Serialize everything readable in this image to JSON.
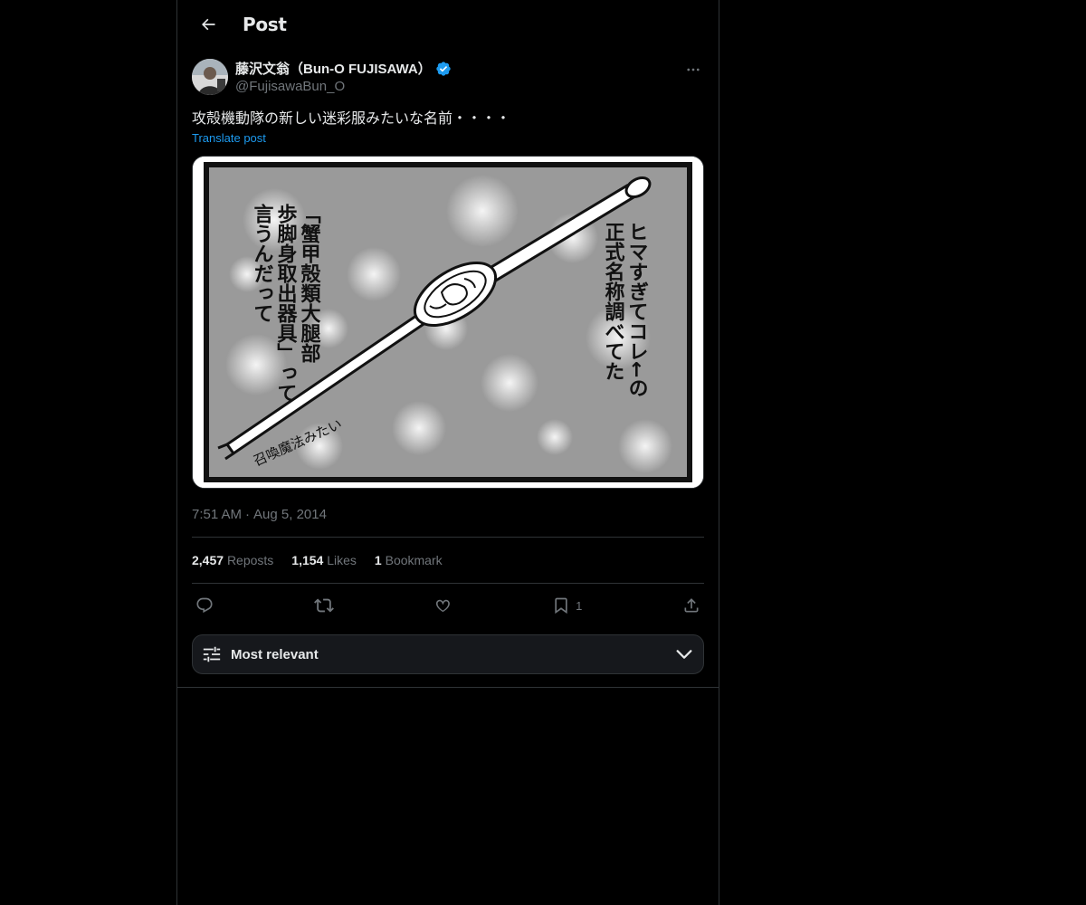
{
  "header": {
    "title": "Post"
  },
  "post": {
    "author": {
      "display_name": "藤沢文翁（Bun-O FUJISAWA）",
      "handle": "@FujisawaBun_O",
      "verified": true
    },
    "text": "攻殻機動隊の新しい迷彩服みたいな名前・・・・",
    "translate_label": "Translate post",
    "media": {
      "right_caption": [
        "ヒマすぎてコレ←の",
        "正式名称調べてた"
      ],
      "left_caption": [
        "「蟹甲殻類大腿部",
        "歩脚身取出器具」って",
        "言うんだって"
      ],
      "spoon_caption": "召喚魔法みたい"
    },
    "time": "7:51 AM",
    "date": "Aug 5, 2014",
    "stats": {
      "reposts_count": "2,457",
      "reposts_label": "Reposts",
      "likes_count": "1,154",
      "likes_label": "Likes",
      "bookmarks_count": "1",
      "bookmarks_label": "Bookmark"
    },
    "actions": {
      "bookmark_count": "1"
    }
  },
  "sort": {
    "label": "Most relevant"
  },
  "colors": {
    "accent": "#1d9bf0",
    "background": "#000000",
    "muted": "#71767b",
    "border": "#2f3336"
  }
}
